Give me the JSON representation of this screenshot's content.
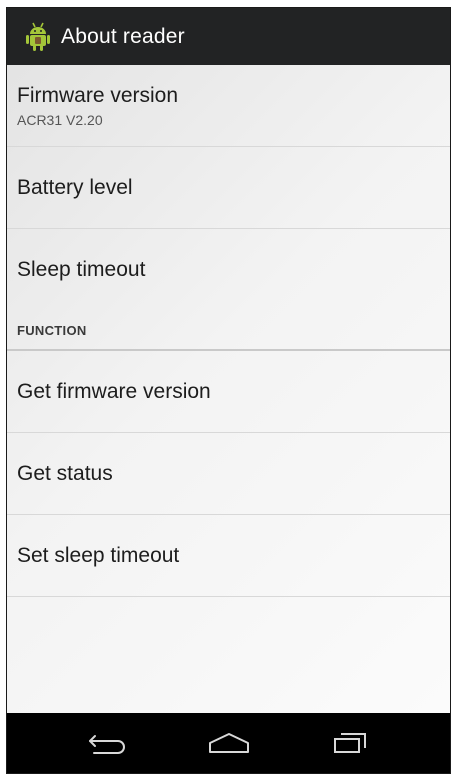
{
  "action_bar": {
    "title": "About reader",
    "icon": "android-robot-icon"
  },
  "items": [
    {
      "primary": "Firmware version",
      "secondary": "ACR31 V2.20"
    },
    {
      "primary": "Battery level"
    },
    {
      "primary": "Sleep timeout"
    }
  ],
  "category": {
    "label": "FUNCTION"
  },
  "function_items": [
    {
      "primary": "Get firmware version"
    },
    {
      "primary": "Get status"
    },
    {
      "primary": "Set sleep timeout"
    }
  ],
  "nav_bar": {
    "back_icon": "back-icon",
    "home_icon": "home-icon",
    "recents_icon": "recents-icon"
  },
  "colors": {
    "action_bar_bg": "#222324",
    "nav_bar_bg": "#000000",
    "android_green": "#a4c639"
  }
}
